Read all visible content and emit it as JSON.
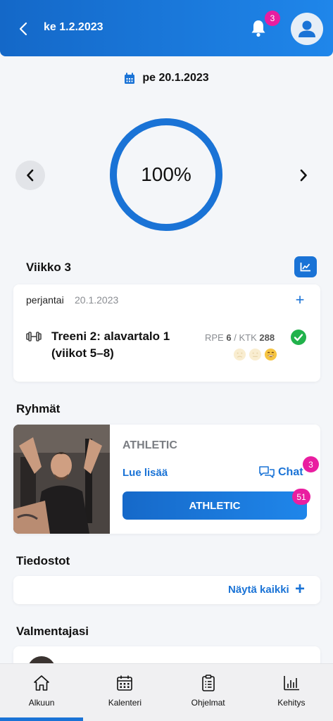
{
  "header": {
    "date_label": "ke 1.2.2023",
    "notification_count": "3"
  },
  "day_view": {
    "date_label": "pe 20.1.2023",
    "progress_text": "100%",
    "progress_fraction": 1.0
  },
  "week": {
    "title": "Viikko 3",
    "day_name": "perjantai",
    "day_date": "20.1.2023",
    "add_label": "+",
    "workout": {
      "title": "Treeni 2: alavartalo 1 (viikot 5–8)",
      "rpe_label": "RPE",
      "rpe_value": "6",
      "ktk_label": "KTK",
      "ktk_value": "288",
      "completed": true
    }
  },
  "groups": {
    "title": "Ryhmät",
    "items": [
      {
        "name": "ATHLETIC",
        "read_more": "Lue lisää",
        "chat_label": "Chat",
        "chat_badge": "3",
        "button_label": "ATHLETIC",
        "button_badge": "51"
      }
    ]
  },
  "files": {
    "title": "Tiedostot",
    "show_all": "Näytä kaikki"
  },
  "coaches": {
    "title": "Valmentajasi"
  },
  "bottom_nav": {
    "items": [
      {
        "label": "Alkuun",
        "icon": "home-icon"
      },
      {
        "label": "Kalenteri",
        "icon": "calendar-icon"
      },
      {
        "label": "Ohjelmat",
        "icon": "clipboard-icon"
      },
      {
        "label": "Kehitys",
        "icon": "bar-chart-icon"
      }
    ],
    "active_index": 0
  },
  "colors": {
    "primary": "#1a73d6",
    "badge": "#e91ea0",
    "success": "#21b24b"
  }
}
